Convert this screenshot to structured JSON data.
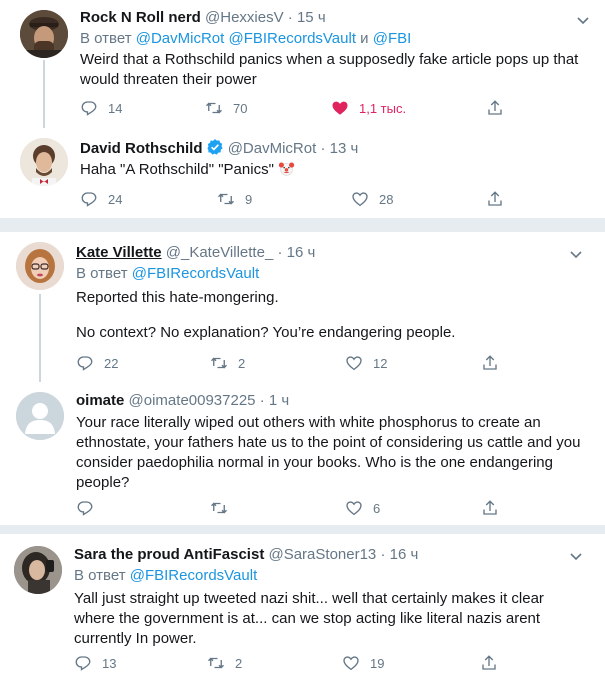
{
  "tweets": [
    {
      "name": "Rock N Roll nerd",
      "handle": "@HexxiesV",
      "dot": "·",
      "time": "15 ч",
      "reply_prefix": "В ответ",
      "reply_to": [
        "@DavMicRot",
        "@FBIRecordsVault"
      ],
      "reply_and": "и",
      "reply_last": "@FBI",
      "text": "Weird that a Rothschild panics when a supposedly fake article pops up that would threaten their power",
      "replies": "14",
      "retweets": "70",
      "likes": "1,1 тыс."
    },
    {
      "name": "David Rothschild",
      "handle": "@DavMicRot",
      "dot": "·",
      "time": "13 ч",
      "text": "Haha \"A Rothschild\" \"Panics\"",
      "replies": "24",
      "retweets": "9",
      "likes": "28"
    },
    {
      "name": "Kate Villette",
      "handle": "@_KateVillette_",
      "dot": "·",
      "time": "16 ч",
      "reply_prefix": "В ответ",
      "reply_to": [
        "@FBIRecordsVault"
      ],
      "text_p1": "Reported this hate-mongering.",
      "text_p2": "No context? No explanation? You’re endangering people.",
      "replies": "22",
      "retweets": "2",
      "likes": "12"
    },
    {
      "name": "oimate",
      "handle": "@oimate00937225",
      "dot": "·",
      "time": "1 ч",
      "text": "Your race literally wiped out others with white phosphorus to create an ethnostate, your fathers hate us to the point of considering us cattle and you consider paedophilia normal in your books. Who is the one endangering people?",
      "replies": "",
      "retweets": "",
      "likes": "6"
    },
    {
      "name": "Sara the proud AntiFascist",
      "handle": "@SaraStoner13",
      "dot": "·",
      "time": "16 ч",
      "reply_prefix": "В ответ",
      "reply_to": [
        "@FBIRecordsVault"
      ],
      "text": "Yall just straight up tweeted nazi shit... well that certainly makes it clear where the government is at... can we stop acting like literal nazis arent currently In power.",
      "replies": "13",
      "retweets": "2",
      "likes": "19"
    }
  ],
  "colors": {
    "link": "#1b95e0",
    "muted": "#657786",
    "like": "#e0245e",
    "separator": "#e6ecf0"
  },
  "icons": [
    "reply-icon",
    "retweet-icon",
    "like-icon",
    "share-icon",
    "caret-down-icon",
    "verified-badge-icon",
    "clown-face-emoji"
  ]
}
